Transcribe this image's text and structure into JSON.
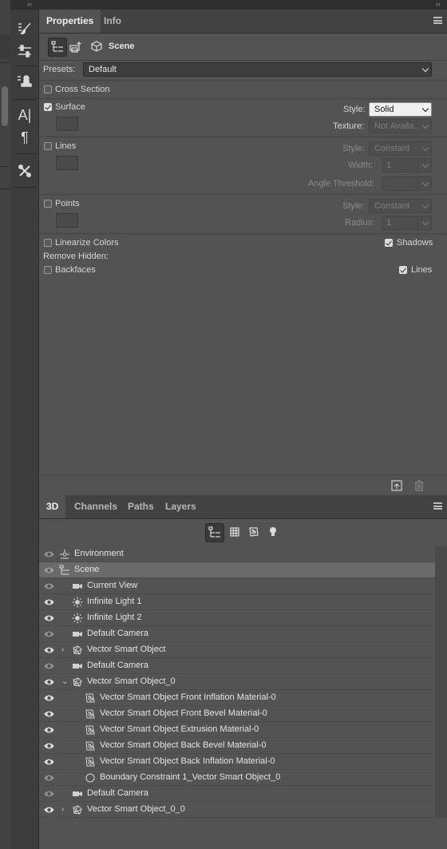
{
  "collapse_left_glyph": "‹‹",
  "collapse_right_glyph": "››",
  "properties_panel": {
    "tabs": [
      {
        "label": "Properties"
      },
      {
        "label": "Info"
      }
    ],
    "title": "Scene",
    "presets_label": "Presets:",
    "presets_value": "Default",
    "cross_section_label": "Cross Section",
    "surface_label": "Surface",
    "surface_style_label": "Style:",
    "surface_style_value": "Solid",
    "texture_label": "Texture:",
    "texture_value": "Not Availa...",
    "lines_label": "Lines",
    "lines_style_label": "Style:",
    "lines_style_value": "Constant",
    "width_label": "Width:",
    "width_value": "1",
    "angle_label": "Angle Threshold:",
    "points_label": "Points",
    "points_style_label": "Style:",
    "points_style_value": "Constant",
    "radius_label": "Radius:",
    "radius_value": "1",
    "linearize_label": "Linearize Colors",
    "shadows_label": "Shadows",
    "remove_hidden_label": "Remove Hidden:",
    "backfaces_label": "Backfaces",
    "lines2_label": "Lines"
  },
  "panel3d": {
    "tabs": [
      {
        "label": "3D"
      },
      {
        "label": "Channels"
      },
      {
        "label": "Paths"
      },
      {
        "label": "Layers"
      }
    ],
    "tree": [
      {
        "label": "Environment",
        "icon": "environment-icon",
        "eye": "dim"
      },
      {
        "label": "Scene",
        "icon": "scene-icon",
        "eye": "dim",
        "selected": true
      },
      {
        "label": "Current View",
        "icon": "camera-icon",
        "eye": "dim"
      },
      {
        "label": "Infinite Light 1",
        "icon": "light-icon",
        "eye": "on"
      },
      {
        "label": "Infinite Light 2",
        "icon": "light-icon",
        "eye": "on"
      },
      {
        "label": "Default Camera",
        "icon": "camera-icon",
        "eye": "dim"
      },
      {
        "label": "Vector Smart Object",
        "icon": "mesh-icon",
        "eye": "on",
        "twirl": "›"
      },
      {
        "label": "Default Camera",
        "icon": "camera-icon",
        "eye": "dim"
      },
      {
        "label": "Vector Smart Object_0",
        "icon": "mesh-icon",
        "eye": "on",
        "twirl": "⌄"
      },
      {
        "label": "Vector Smart Object Front Inflation Material-0",
        "icon": "material-icon",
        "eye": "on"
      },
      {
        "label": "Vector Smart Object Front Bevel Material-0",
        "icon": "material-icon",
        "eye": "on"
      },
      {
        "label": "Vector Smart Object Extrusion Material-0",
        "icon": "material-icon",
        "eye": "on"
      },
      {
        "label": "Vector Smart Object Back Bevel Material-0",
        "icon": "material-icon",
        "eye": "on"
      },
      {
        "label": "Vector Smart Object Back Inflation Material-0",
        "icon": "material-icon",
        "eye": "on"
      },
      {
        "label": "Boundary Constraint 1_Vector Smart Object_0",
        "icon": "constraint-icon",
        "eye": "dim"
      },
      {
        "label": "Default Camera",
        "icon": "camera-icon",
        "eye": "dim"
      },
      {
        "label": "Vector Smart Object_0_0",
        "icon": "mesh-icon",
        "eye": "on",
        "twirl": "›"
      }
    ]
  }
}
